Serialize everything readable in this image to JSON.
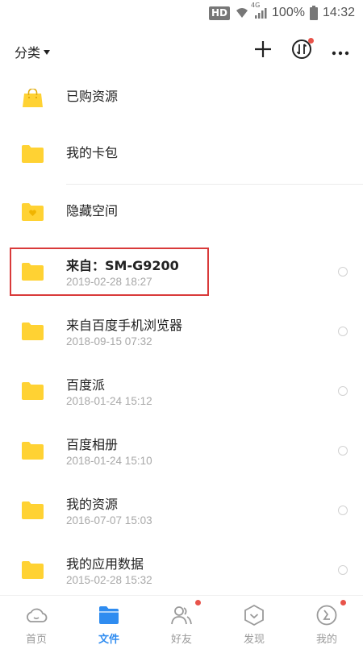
{
  "status_bar": {
    "hd": "HD",
    "network": "4G",
    "battery": "100%",
    "time": "14:32"
  },
  "header": {
    "category_label": "分类",
    "add_icon": "plus-icon",
    "transfer_icon": "transfer-icon",
    "more_icon": "more-dots-icon"
  },
  "files": [
    {
      "name": "已购资源",
      "date": "",
      "icon": "shopping-bag-folder-icon"
    },
    {
      "name": "我的卡包",
      "date": "",
      "icon": "folder-icon"
    },
    {
      "name": "隐藏空间",
      "date": "",
      "icon": "heart-folder-icon"
    },
    {
      "name": "来自：SM-G9200",
      "date": "2019-02-28  18:27",
      "icon": "folder-icon"
    },
    {
      "name": "来自百度手机浏览器",
      "date": "2018-09-15  07:32",
      "icon": "folder-icon"
    },
    {
      "name": "百度派",
      "date": "2018-01-24  15:12",
      "icon": "folder-icon"
    },
    {
      "name": "百度相册",
      "date": "2018-01-24  15:10",
      "icon": "folder-icon"
    },
    {
      "name": "我的资源",
      "date": "2016-07-07  15:03",
      "icon": "folder-icon"
    },
    {
      "name": "我的应用数据",
      "date": "2015-02-28  15:32",
      "icon": "folder-icon"
    }
  ],
  "nav": [
    {
      "label": "首页",
      "icon": "cloud-home-icon",
      "active": false
    },
    {
      "label": "文件",
      "icon": "file-folder-icon",
      "active": true
    },
    {
      "label": "好友",
      "icon": "friends-icon",
      "active": false
    },
    {
      "label": "发现",
      "icon": "discover-icon",
      "active": false
    },
    {
      "label": "我的",
      "icon": "profile-icon",
      "active": false
    }
  ],
  "colors": {
    "folder": "#ffd233",
    "accent": "#2f8cf0",
    "highlight_border": "#d93a3a",
    "badge_dot": "#e8534a"
  }
}
